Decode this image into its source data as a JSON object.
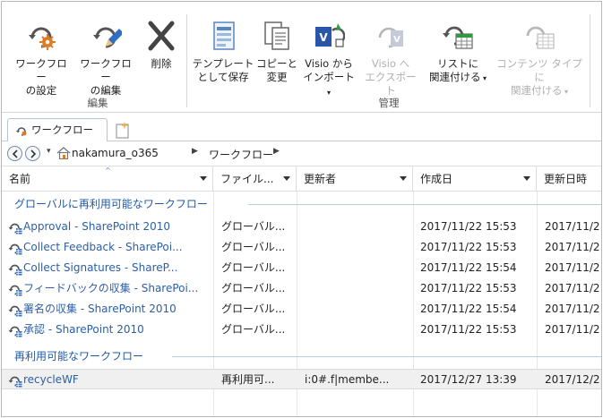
{
  "ribbon": {
    "groups": [
      {
        "label": "編集",
        "buttons": [
          {
            "label_line1": "ワークフロー",
            "label_line2": "の設定",
            "icon": "workflow-settings-icon",
            "enabled": true
          },
          {
            "label_line1": "ワークフロー",
            "label_line2": "の編集",
            "icon": "workflow-edit-icon",
            "enabled": true
          },
          {
            "label_line1": "削除",
            "label_line2": "",
            "icon": "delete-icon",
            "enabled": true
          }
        ]
      },
      {
        "label": "管理",
        "buttons": [
          {
            "label_line1": "テンプレート",
            "label_line2": "として保存",
            "icon": "save-as-template-icon",
            "enabled": true
          },
          {
            "label_line1": "コピーと",
            "label_line2": "変更",
            "icon": "copy-modify-icon",
            "enabled": true
          },
          {
            "label_line1": "Visio から",
            "label_line2": "インポート",
            "icon": "visio-import-icon",
            "enabled": true,
            "dropdown": true
          },
          {
            "label_line1": "Visio へ",
            "label_line2": "エクスポート",
            "icon": "visio-export-icon",
            "enabled": false
          },
          {
            "label_line1": "リストに",
            "label_line2": "関連付ける",
            "icon": "associate-list-icon",
            "enabled": true,
            "dropdown": true
          },
          {
            "label_line1": "コンテンツ タイプに",
            "label_line2": "関連付ける",
            "icon": "associate-content-type-icon",
            "enabled": false,
            "dropdown": true
          }
        ]
      }
    ]
  },
  "tabs": [
    {
      "label": "ワークフロー",
      "icon": "workflow-icon",
      "active": true
    }
  ],
  "breadcrumb": {
    "items": [
      "nakamura_o365",
      "ワークフロー"
    ]
  },
  "list": {
    "columns": [
      {
        "label": "名前",
        "sortable": true
      },
      {
        "label": "ファイル...",
        "dropdown": true
      },
      {
        "label": "更新者",
        "dropdown": true
      },
      {
        "label": "作成日",
        "dropdown": true
      },
      {
        "label": "更新日時",
        "dropdown": false
      }
    ],
    "groups": [
      {
        "title": "グローバルに再利用可能なワークフロー",
        "rows": [
          {
            "name": "Approval - SharePoint 2010",
            "type": "グローバル...",
            "modified_by": "",
            "created": "2017/11/22 15:53",
            "modified": "2017/11/2"
          },
          {
            "name": "Collect Feedback - SharePoi...",
            "type": "グローバル...",
            "modified_by": "",
            "created": "2017/11/22 15:53",
            "modified": "2017/11/2"
          },
          {
            "name": "Collect Signatures - ShareP...",
            "type": "グローバル...",
            "modified_by": "",
            "created": "2017/11/22 15:54",
            "modified": "2017/11/2"
          },
          {
            "name": "フィードバックの収集 - SharePoi...",
            "type": "グローバル...",
            "modified_by": "",
            "created": "2017/11/22 15:53",
            "modified": "2017/11/2"
          },
          {
            "name": "署名の収集 - SharePoint 2010",
            "type": "グローバル...",
            "modified_by": "",
            "created": "2017/11/22 15:54",
            "modified": "2017/11/2"
          },
          {
            "name": "承認 - SharePoint 2010",
            "type": "グローバル...",
            "modified_by": "",
            "created": "2017/11/22 15:53",
            "modified": "2017/11/2"
          }
        ]
      },
      {
        "title": "再利用可能なワークフロー",
        "rows": [
          {
            "name": "recycleWF",
            "type": "再利用可...",
            "modified_by": "i:0#.f|membe...",
            "created": "2017/12/27 13:39",
            "modified": "2017/12/2",
            "selected": true
          }
        ]
      }
    ]
  },
  "colors": {
    "link_blue": "#2b5fa6",
    "group_blue": "#1f5aa8",
    "accent_orange": "#e07a22"
  }
}
